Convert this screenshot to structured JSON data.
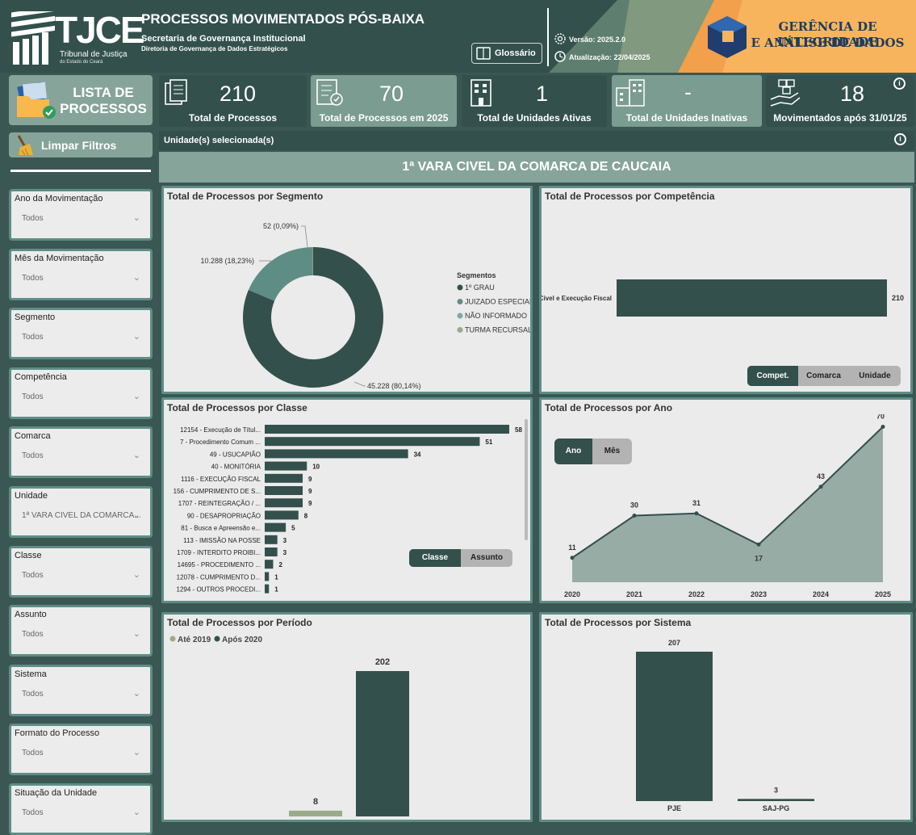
{
  "header": {
    "logo_text": "TJCE",
    "logo_sub1": "Tribunal de Justiça",
    "logo_sub2": "do Estado do Ceará",
    "title": "PROCESSOS MOVIMENTADOS PÓS-BAIXA",
    "subtitle": "Secretaria de Governança Institucional",
    "subtitle2": "Diretoria de Governança de Dados Estratégicos",
    "glossary_label": "Glossário",
    "version_label": "Versão: 2025.2.0",
    "update_label": "Atualização: 22/04/2025",
    "brand_line1": "GERÊNCIA DE INTEGRIDADE",
    "brand_line2": "E ANÁLISE DE DADOS"
  },
  "sidebar": {
    "list_label_1": "LISTA DE",
    "list_label_2": "PROCESSOS",
    "clear_label": "Limpar Filtros",
    "filters": [
      {
        "label": "Ano da Movimentação",
        "value": "Todos"
      },
      {
        "label": "Mês da Movimentação",
        "value": "Todos"
      },
      {
        "label": "Segmento",
        "value": "Todos"
      },
      {
        "label": "Competência",
        "value": "Todos"
      },
      {
        "label": "Comarca",
        "value": "Todos"
      },
      {
        "label": "Unidade",
        "value": "1ª VARA CIVEL DA COMARCA..."
      },
      {
        "label": "Classe",
        "value": "Todos"
      },
      {
        "label": "Assunto",
        "value": "Todos"
      },
      {
        "label": "Sistema",
        "value": "Todos"
      },
      {
        "label": "Formato do Processo",
        "value": "Todos"
      },
      {
        "label": "Situação da Unidade",
        "value": "Todos"
      }
    ]
  },
  "kpis": [
    {
      "value": "210",
      "label": "Total de Processos"
    },
    {
      "value": "70",
      "label": "Total de Processos em  2025"
    },
    {
      "value": "1",
      "label": "Total de Unidades Ativas"
    },
    {
      "value": "-",
      "label": "Total de Unidades Inativas"
    },
    {
      "value": "18",
      "label": "Movimentados após 31/01/25"
    }
  ],
  "info_icon_glyph": "i",
  "selection": {
    "label": "Unidade(s) selecionada(s)",
    "value": "1ª VARA CIVEL DA COMARCA DE CAUCAIA"
  },
  "colors": {
    "dark_teal": "#33504c",
    "mid_teal": "#5e8d86",
    "sage": "#9aab8a",
    "grey_green": "#98aca6",
    "panel_bg": "#ebebeb"
  },
  "toggles": {
    "competencia": [
      "Compet.",
      "Comarca",
      "Unidade"
    ],
    "classe": [
      "Classe",
      "Assunto"
    ],
    "ano": [
      "Ano",
      "Mês"
    ]
  },
  "chart_data": [
    {
      "type": "pie",
      "title": "Total de Processos por Segmento",
      "legend_title": "Segmentos",
      "categories": [
        "1º GRAU",
        "JUIZADO ESPECIAL",
        "NÃO INFORMADO",
        "TURMA RECURSAL"
      ],
      "values": [
        45228,
        10288,
        0,
        52
      ],
      "data_labels": [
        "45.228 (80,14%)",
        "10.288 (18,23%)",
        "",
        "52 (0,09%)"
      ],
      "colors": [
        "#33504c",
        "#5e8d86",
        "#7fa9a2",
        "#9aab8a"
      ],
      "legend_position": "right"
    },
    {
      "type": "bar",
      "title": "Total de Processos por Competência",
      "orientation": "horizontal",
      "categories": [
        "Civel e Execução Fiscal"
      ],
      "values": [
        210
      ]
    },
    {
      "type": "bar",
      "title": "Total de Processos por Classe",
      "orientation": "horizontal",
      "categories": [
        "12154 - Execução de Títul...",
        "7 - Procedimento Comum ...",
        "49 - USUCAPIÃO",
        "40 - MONITÓRIA",
        "1116 - EXECUÇÃO FISCAL",
        "156 - CUMPRIMENTO DE S...",
        "1707 - REINTEGRAÇÃO / ...",
        "90 - DESAPROPRIAÇÃO",
        "81 - Busca e Apreensão e...",
        "113 - IMISSÃO NA POSSE",
        "1709 - INTERDITO PROIBI...",
        "14695 - PROCEDIMENTO ...",
        "12078 - CUMPRIMENTO D...",
        "1294 - OUTROS PROCEDI..."
      ],
      "values": [
        58,
        51,
        34,
        10,
        9,
        9,
        9,
        8,
        5,
        3,
        3,
        2,
        1,
        1
      ]
    },
    {
      "type": "area",
      "title": "Total de Processos por Ano",
      "x": [
        "2020",
        "2021",
        "2022",
        "2023",
        "2024",
        "2025"
      ],
      "values": [
        11,
        30,
        31,
        17,
        43,
        70
      ],
      "ylim": [
        0,
        72
      ]
    },
    {
      "type": "bar",
      "title": "Total de Processos por Período",
      "categories": [
        ""
      ],
      "series": [
        {
          "name": "Até 2019",
          "values": [
            8
          ],
          "color": "#9aab8a"
        },
        {
          "name": "Após 2020",
          "values": [
            202
          ],
          "color": "#33504c"
        }
      ],
      "legend_position": "top-left"
    },
    {
      "type": "bar",
      "title": "Total de Processos por Sistema",
      "categories": [
        "PJE",
        "SAJ-PG"
      ],
      "values": [
        207,
        3
      ]
    }
  ]
}
